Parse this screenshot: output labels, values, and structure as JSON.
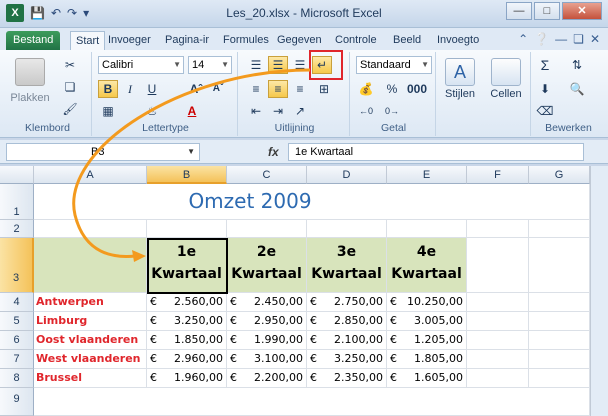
{
  "window": {
    "title": "Les_20.xlsx - Microsoft Excel"
  },
  "tabs": [
    "Bestand",
    "Start",
    "Invoeger",
    "Pagina-ir",
    "Formules",
    "Gegeven",
    "Controle",
    "Beeld",
    "Invoegto"
  ],
  "ribbon": {
    "paste_label": "Plakken",
    "font_name": "Calibri",
    "font_size": "14",
    "number_format": "Standaard",
    "styles_label": "Stijlen",
    "cells_label": "Cellen",
    "groups": [
      "Klembord",
      "Lettertype",
      "Uitlijning",
      "Getal",
      "Bewerken"
    ]
  },
  "formula_bar": {
    "name_box": "B3",
    "fx": "fx",
    "content": "1e Kwartaal"
  },
  "sheet": {
    "columns": [
      "A",
      "B",
      "C",
      "D",
      "E",
      "F",
      "G"
    ],
    "rows": [
      "1",
      "2",
      "3",
      "4",
      "5",
      "6",
      "7",
      "8",
      "9"
    ],
    "title": "Omzet 2009",
    "quarter_headers": [
      [
        "1e",
        "Kwartaal"
      ],
      [
        "2e",
        "Kwartaal"
      ],
      [
        "3e",
        "Kwartaal"
      ],
      [
        "4e",
        "Kwartaal"
      ]
    ],
    "currency": "€",
    "data": [
      {
        "region": "Antwerpen",
        "values": [
          "2.560,00",
          "2.450,00",
          "2.750,00",
          "10.250,00"
        ]
      },
      {
        "region": "Limburg",
        "values": [
          "3.250,00",
          "2.950,00",
          "2.850,00",
          "3.005,00"
        ]
      },
      {
        "region": "Oost vlaanderen",
        "values": [
          "1.850,00",
          "1.990,00",
          "2.100,00",
          "1.205,00"
        ]
      },
      {
        "region": "West vlaanderen",
        "values": [
          "2.960,00",
          "3.100,00",
          "3.250,00",
          "1.805,00"
        ]
      },
      {
        "region": "Brussel",
        "values": [
          "1.960,00",
          "2.200,00",
          "2.350,00",
          "1.605,00"
        ]
      }
    ]
  },
  "colors": {
    "header_fill": "#d8e4bc",
    "region_text": "#e0262c",
    "title_text": "#2d6ab1",
    "highlight": "#e0262c",
    "arrow": "#f39a1e"
  }
}
